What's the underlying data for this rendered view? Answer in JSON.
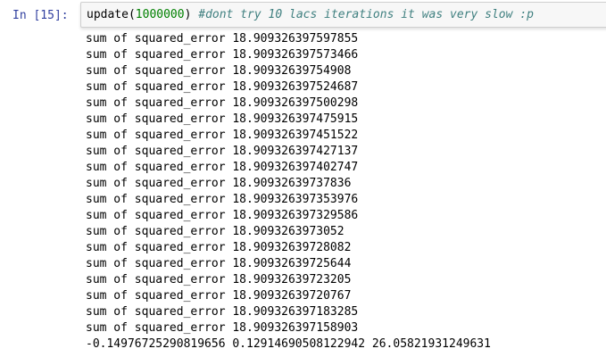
{
  "cell": {
    "prompt": "In [15]:",
    "input": {
      "func": "update(",
      "arg": "1000000",
      "close": ") ",
      "comment": "#dont try 10 lacs iterations it was very slow :p"
    }
  },
  "output": {
    "lines": [
      "sum of squared_error 18.909326397597855",
      "sum of squared_error 18.909326397573466",
      "sum of squared_error 18.90932639754908",
      "sum of squared_error 18.909326397524687",
      "sum of squared_error 18.909326397500298",
      "sum of squared_error 18.909326397475915",
      "sum of squared_error 18.909326397451522",
      "sum of squared_error 18.909326397427137",
      "sum of squared_error 18.909326397402747",
      "sum of squared_error 18.90932639737836",
      "sum of squared_error 18.909326397353976",
      "sum of squared_error 18.909326397329586",
      "sum of squared_error 18.9093263973052",
      "sum of squared_error 18.90932639728082",
      "sum of squared_error 18.90932639725644",
      "sum of squared_error 18.90932639723205",
      "sum of squared_error 18.90932639720767",
      "sum of squared_error 18.909326397183285",
      "sum of squared_error 18.909326397158903"
    ],
    "final": "-0.14976725290819656 0.12914690508122942 26.05821931249631"
  }
}
